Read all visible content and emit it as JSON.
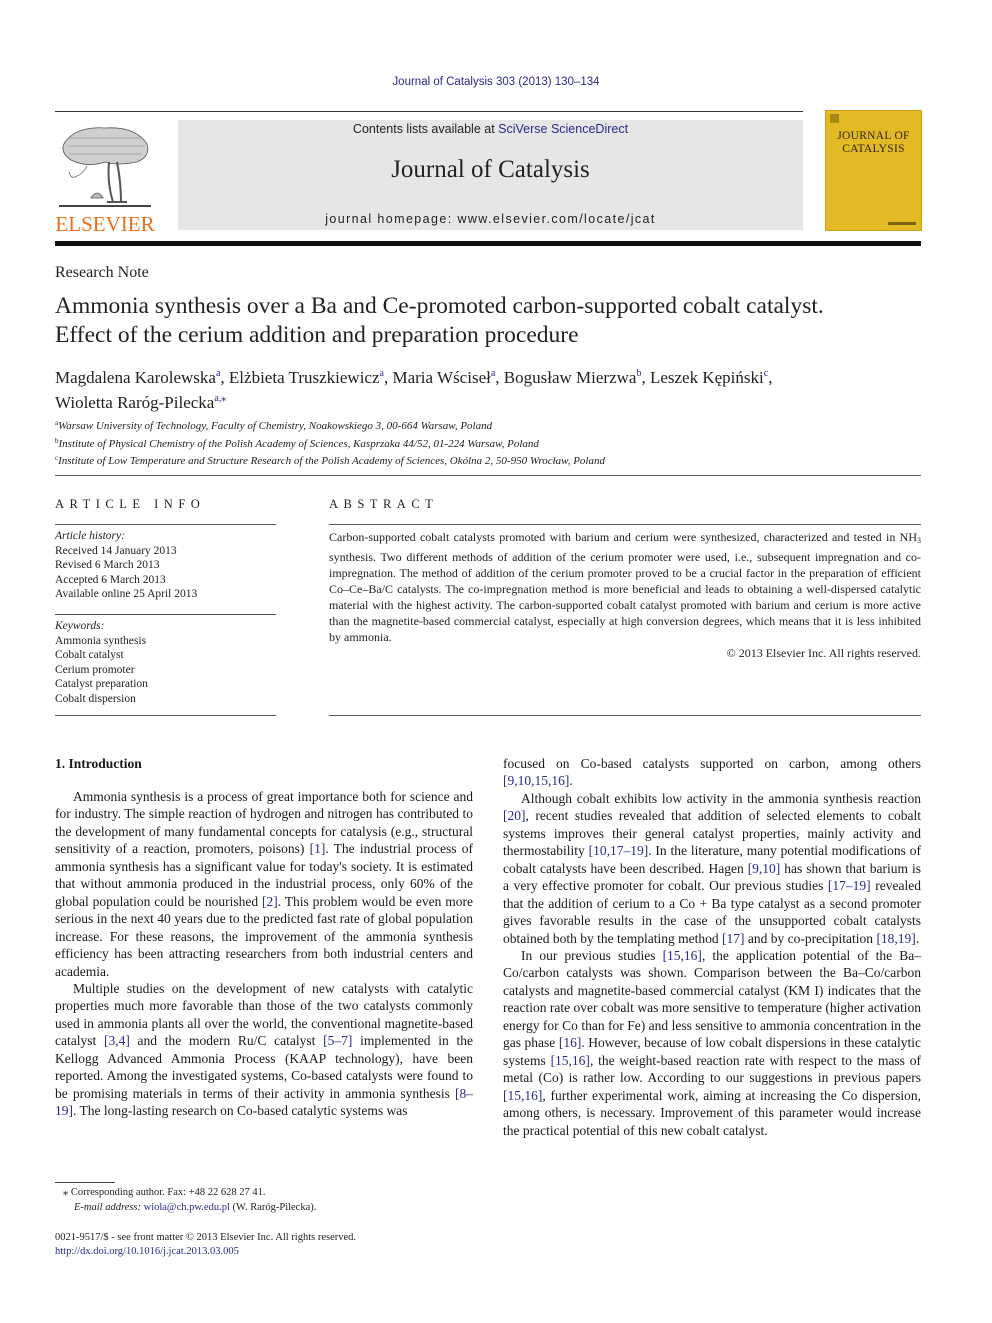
{
  "header": {
    "citation": "Journal of Catalysis 303 (2013) 130–134",
    "contents_prefix": "Contents lists available at ",
    "contents_link": "SciVerse ScienceDirect",
    "journal_title": "Journal of Catalysis",
    "homepage": "journal homepage: www.elsevier.com/locate/jcat",
    "publisher_logo": "ELSEVIER",
    "cover_title_line1": "JOURNAL OF",
    "cover_title_line2": "CATALYSIS",
    "colors": {
      "link": "#2a2a8c",
      "publisher_orange": "#e9711c",
      "cover_yellow": "#e3b925",
      "banner_gray": "#e6e6e6"
    }
  },
  "article": {
    "type": "Research Note",
    "title_line1": "Ammonia synthesis over a Ba and Ce-promoted carbon-supported cobalt catalyst.",
    "title_line2": "Effect of the cerium addition and preparation procedure",
    "authors": [
      {
        "name": "Magdalena Karolewska",
        "aff": "a",
        "sep": ", "
      },
      {
        "name": "Elżbieta Truszkiewicz",
        "aff": "a",
        "sep": ", "
      },
      {
        "name": "Maria Wściseł",
        "aff": "a",
        "sep": ", "
      },
      {
        "name": "Bogusław Mierzwa",
        "aff": "b",
        "sep": ", "
      },
      {
        "name": "Leszek Kępiński",
        "aff": "c",
        "sep": ","
      },
      {
        "name": "Wioletta Raróg-Pilecka",
        "aff": "a,⁎",
        "sep": ""
      }
    ],
    "affiliations": [
      {
        "key": "a",
        "text": "Warsaw University of Technology, Faculty of Chemistry, Noakowskiego 3, 00-664 Warsaw, Poland"
      },
      {
        "key": "b",
        "text": "Institute of Physical Chemistry of the Polish Academy of Sciences, Kasprzaka 44/52, 01-224 Warsaw, Poland"
      },
      {
        "key": "c",
        "text": "Institute of Low Temperature and Structure Research of the Polish Academy of Sciences, Okólna 2, 50-950 Wrocław, Poland"
      }
    ]
  },
  "article_info": {
    "heading": "ARTICLE INFO",
    "history_label": "Article history:",
    "history": [
      "Received 14 January 2013",
      "Revised 6 March 2013",
      "Accepted 6 March 2013",
      "Available online 25 April 2013"
    ],
    "keywords_label": "Keywords:",
    "keywords": [
      "Ammonia synthesis",
      "Cobalt catalyst",
      "Cerium promoter",
      "Catalyst preparation",
      "Cobalt dispersion"
    ]
  },
  "abstract": {
    "heading": "ABSTRACT",
    "text_before_sub": "Carbon-supported cobalt catalysts promoted with barium and cerium were synthesized, characterized and tested in NH",
    "sub": "3",
    "text_after_sub": " synthesis. Two different methods of addition of the cerium promoter were used, i.e., subsequent impregnation and co-impregnation. The method of addition of the cerium promoter proved to be a crucial factor in the preparation of efficient Co–Ce–Ba/C catalysts. The co-impregnation method is more beneficial and leads to obtaining a well-dispersed catalytic material with the highest activity. The carbon-supported cobalt catalyst promoted with barium and cerium is more active than the magnetite-based commercial catalyst, especially at high conversion degrees, which means that it is less inhibited by ammonia.",
    "copyright": "© 2013 Elsevier Inc. All rights reserved."
  },
  "body": {
    "section_heading": "1. Introduction",
    "left_paragraphs": [
      [
        {
          "t": "Ammonia synthesis is a process of great importance both for science and for industry. The simple reaction of hydrogen and nitrogen has contributed to the development of many fundamental concepts for catalysis (e.g., structural sensitivity of a reaction, promoters, poisons) "
        },
        {
          "r": "[1]"
        },
        {
          "t": ". The industrial process of ammonia synthesis has a significant value for today's society. It is estimated that without ammonia produced in the industrial process, only 60% of the global population could be nourished "
        },
        {
          "r": "[2]"
        },
        {
          "t": ". This problem would be even more serious in the next 40 years due to the predicted fast rate of global population increase. For these reasons, the improvement of the ammonia synthesis efficiency has been attracting researchers from both industrial centers and academia."
        }
      ],
      [
        {
          "t": "Multiple studies on the development of new catalysts with catalytic properties much more favorable than those of the two catalysts commonly used in ammonia plants all over the world, the conventional magnetite-based catalyst "
        },
        {
          "r": "[3,4]"
        },
        {
          "t": " and the modern Ru/C catalyst "
        },
        {
          "r": "[5–7]"
        },
        {
          "t": " implemented in the Kellogg Advanced Ammonia Process (KAAP technology), have been reported. Among the investigated systems, Co-based catalysts were found to be promising materials in terms of their activity in ammonia synthesis "
        },
        {
          "r": "[8–19]"
        },
        {
          "t": ". The long-lasting research on Co-based catalytic systems was"
        }
      ]
    ],
    "right_paragraphs": [
      [
        {
          "t": "focused on Co-based catalysts supported on carbon, among others "
        },
        {
          "r": "[9,10,15,16]"
        },
        {
          "t": "."
        }
      ],
      [
        {
          "t": "Although cobalt exhibits low activity in the ammonia synthesis reaction "
        },
        {
          "r": "[20]"
        },
        {
          "t": ", recent studies revealed that addition of selected elements to cobalt systems improves their general catalyst properties, mainly activity and thermostability "
        },
        {
          "r": "[10,17–19]"
        },
        {
          "t": ". In the literature, many potential modifications of cobalt catalysts have been described. Hagen "
        },
        {
          "r": "[9,10]"
        },
        {
          "t": " has shown that barium is a very effective promoter for cobalt. Our previous studies "
        },
        {
          "r": "[17–19]"
        },
        {
          "t": " revealed that the addition of cerium to a Co + Ba type catalyst as a second promoter gives favorable results in the case of the unsupported cobalt catalysts obtained both by the templating method "
        },
        {
          "r": "[17]"
        },
        {
          "t": " and by co-precipitation "
        },
        {
          "r": "[18,19]"
        },
        {
          "t": "."
        }
      ],
      [
        {
          "t": "In our previous studies "
        },
        {
          "r": "[15,16]"
        },
        {
          "t": ", the application potential of the Ba–Co/carbon catalysts was shown. Comparison between the Ba–Co/carbon catalysts and magnetite-based commercial catalyst (KM I) indicates that the reaction rate over cobalt was more sensitive to temperature (higher activation energy for Co than for Fe) and less sensitive to ammonia concentration in the gas phase "
        },
        {
          "r": "[16]"
        },
        {
          "t": ". However, because of low cobalt dispersions in these catalytic systems "
        },
        {
          "r": "[15,16]"
        },
        {
          "t": ", the weight-based reaction rate with respect to the mass of metal (Co) is rather low. According to our suggestions in previous papers "
        },
        {
          "r": "[15,16]"
        },
        {
          "t": ", further experimental work, aiming at increasing the Co dispersion, among others, is necessary. Improvement of this parameter would increase the practical potential of this new cobalt catalyst."
        }
      ]
    ]
  },
  "footnote": {
    "star": "⁎",
    "corresponding": "Corresponding author. Fax: +48 22 628 27 41.",
    "email_label": "E-mail address:",
    "email": "wiola@ch.pw.edu.pl",
    "email_owner": " (W. Raróg-Pilecka)."
  },
  "front_matter": {
    "issn_line": "0021-9517/$ - see front matter © 2013 Elsevier Inc. All rights reserved.",
    "doi": "http://dx.doi.org/10.1016/j.jcat.2013.03.005"
  }
}
